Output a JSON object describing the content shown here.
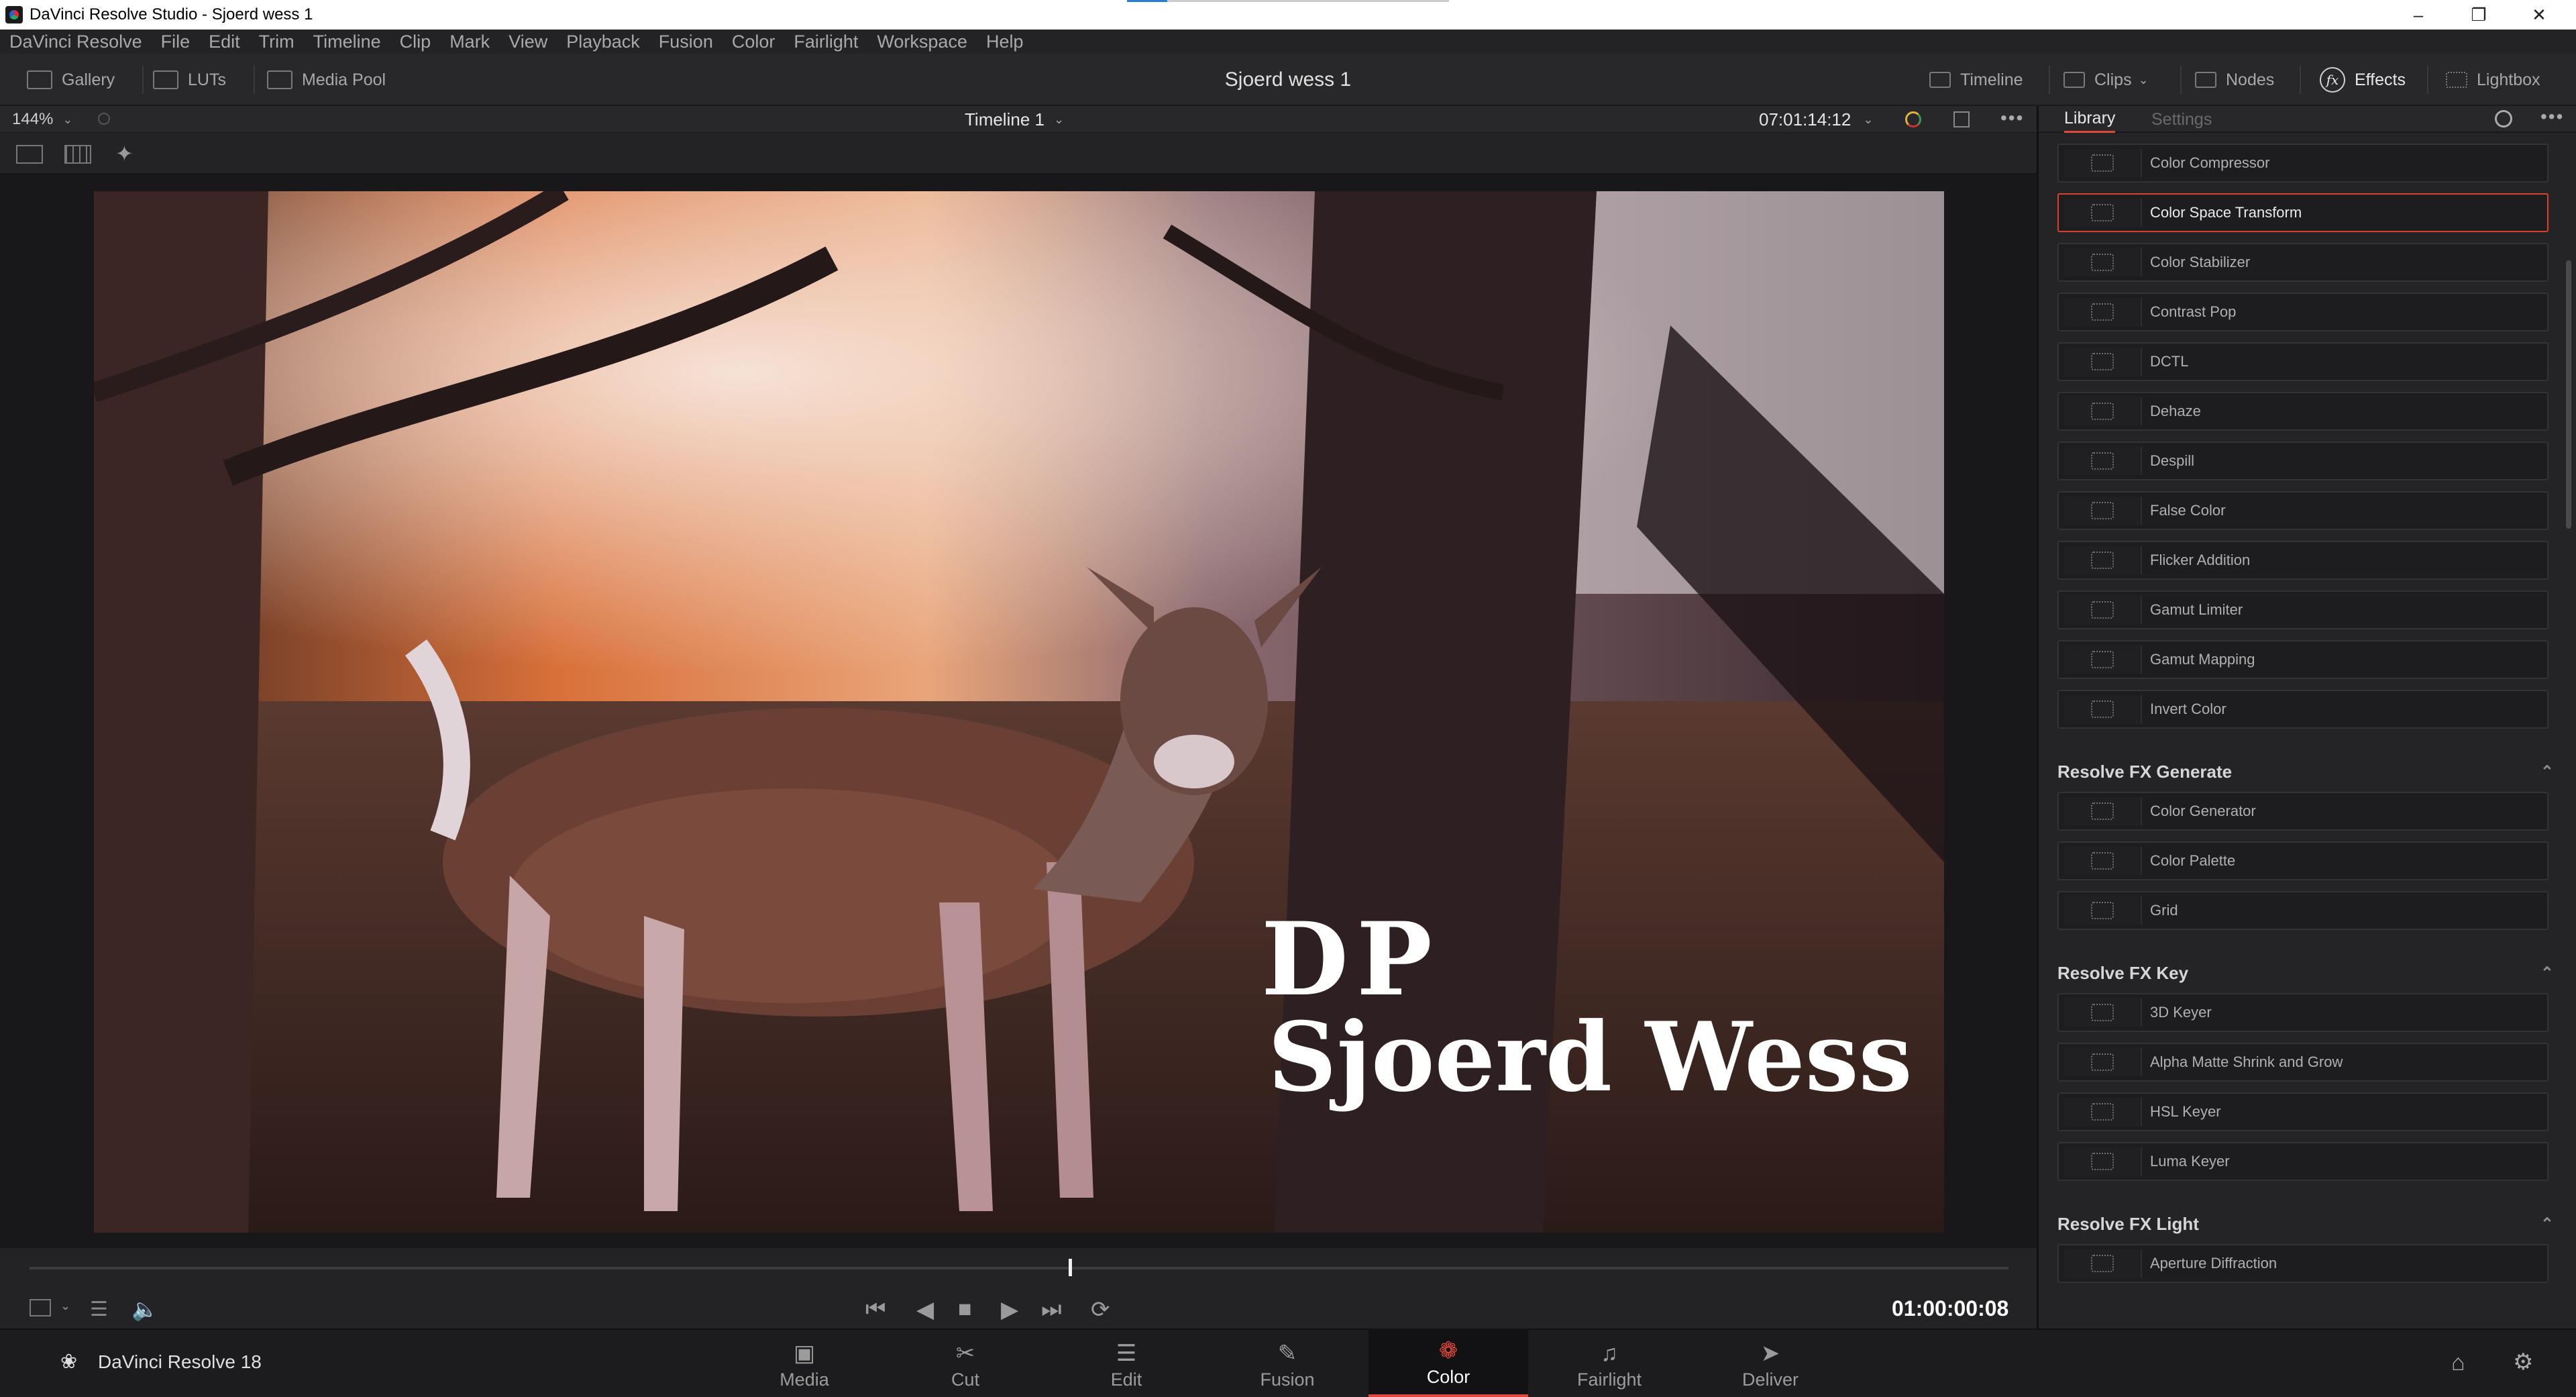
{
  "window": {
    "title": "DaVinci Resolve Studio - Sjoerd wess 1"
  },
  "menu": [
    "DaVinci Resolve",
    "File",
    "Edit",
    "Trim",
    "Timeline",
    "Clip",
    "Mark",
    "View",
    "Playback",
    "Fusion",
    "Color",
    "Fairlight",
    "Workspace",
    "Help"
  ],
  "toolbar": {
    "gallery": "Gallery",
    "luts": "LUTs",
    "media_pool": "Media Pool",
    "project_title": "Sjoerd wess 1",
    "timeline": "Timeline",
    "clips": "Clips",
    "nodes": "Nodes",
    "effects": "Effects",
    "lightbox": "Lightbox"
  },
  "viewer": {
    "zoom": "144%",
    "timeline_name": "Timeline 1",
    "source_timecode": "07:01:14:12",
    "playhead_fraction": 0.525,
    "current_timecode": "01:00:00:08"
  },
  "overlay": {
    "line1": "DP",
    "line2": "Sjoerd Wess"
  },
  "library": {
    "tabs": [
      "Library",
      "Settings"
    ],
    "items_top": [
      "Color Compressor",
      "Color Space Transform",
      "Color Stabilizer",
      "Contrast Pop",
      "DCTL",
      "Dehaze",
      "Despill",
      "False Color",
      "Flicker Addition",
      "Gamut Limiter",
      "Gamut Mapping",
      "Invert Color"
    ],
    "selected": "Color Space Transform",
    "sections": [
      {
        "title": "Resolve FX Generate",
        "items": [
          "Color Generator",
          "Color Palette",
          "Grid"
        ]
      },
      {
        "title": "Resolve FX Key",
        "items": [
          "3D Keyer",
          "Alpha Matte Shrink and Grow",
          "HSL Keyer",
          "Luma Keyer"
        ]
      },
      {
        "title": "Resolve FX Light",
        "items": [
          "Aperture Diffraction"
        ]
      }
    ]
  },
  "pages": {
    "brand": "DaVinci Resolve 18",
    "items": [
      "Media",
      "Cut",
      "Edit",
      "Fusion",
      "Color",
      "Fairlight",
      "Deliver"
    ],
    "active": "Color"
  },
  "colors": {
    "accent": "#e0483b",
    "panel": "#242426",
    "background": "#1e1e20"
  }
}
